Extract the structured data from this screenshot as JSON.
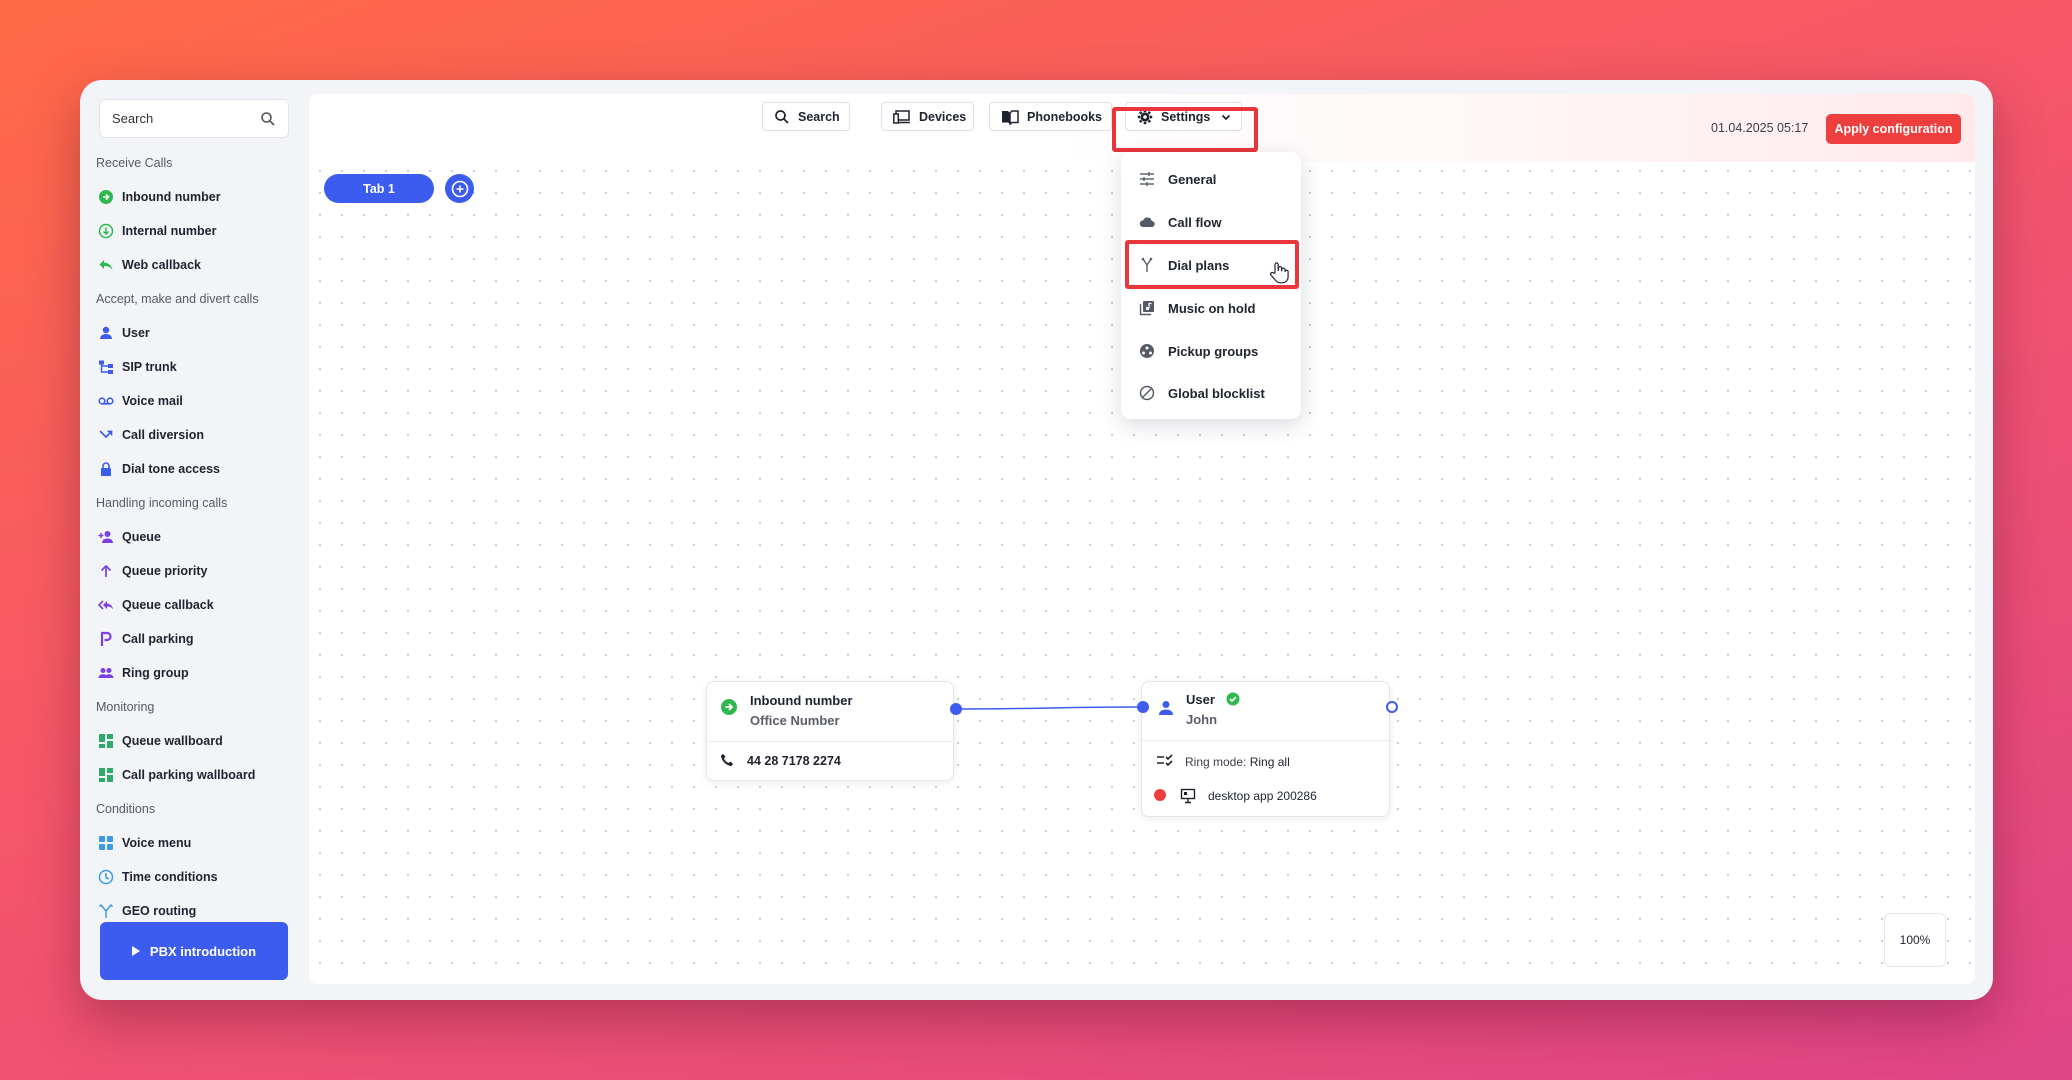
{
  "sidebar": {
    "search_label": "Search",
    "sections": [
      {
        "title": "Receive Calls",
        "items": [
          {
            "label": "Inbound number",
            "icon": "arrow-circle-right-icon"
          },
          {
            "label": "Internal number",
            "icon": "arrow-circle-down-icon"
          },
          {
            "label": "Web callback",
            "icon": "reply-icon"
          }
        ]
      },
      {
        "title": "Accept, make and divert calls",
        "items": [
          {
            "label": "User",
            "icon": "user-icon"
          },
          {
            "label": "SIP trunk",
            "icon": "sip-trunk-icon"
          },
          {
            "label": "Voice mail",
            "icon": "voicemail-icon"
          },
          {
            "label": "Call diversion",
            "icon": "call-diversion-icon"
          },
          {
            "label": "Dial tone access",
            "icon": "lock-icon"
          }
        ]
      },
      {
        "title": "Handling incoming calls",
        "items": [
          {
            "label": "Queue",
            "icon": "queue-user-add-icon"
          },
          {
            "label": "Queue priority",
            "icon": "arrow-up-icon"
          },
          {
            "label": "Queue callback",
            "icon": "reply-all-icon"
          },
          {
            "label": "Call parking",
            "icon": "parking-icon"
          },
          {
            "label": "Ring group",
            "icon": "group-icon"
          }
        ]
      },
      {
        "title": "Monitoring",
        "items": [
          {
            "label": "Queue wallboard",
            "icon": "dashboard-icon"
          },
          {
            "label": "Call parking wallboard",
            "icon": "dashboard-icon"
          }
        ]
      },
      {
        "title": "Conditions",
        "items": [
          {
            "label": "Voice menu",
            "icon": "grid-icon"
          },
          {
            "label": "Time conditions",
            "icon": "clock-icon"
          },
          {
            "label": "GEO routing",
            "icon": "fork-icon"
          }
        ]
      }
    ],
    "pbx_button": "PBX introduction"
  },
  "topbar": {
    "search": "Search",
    "devices": "Devices",
    "phonebooks": "Phonebooks",
    "settings": "Settings",
    "date": "01.04.2025 05:17",
    "apply": "Apply configuration"
  },
  "tabs": {
    "tab1": "Tab 1"
  },
  "settings_menu": [
    {
      "label": "General",
      "icon": "sliders-icon"
    },
    {
      "label": "Call flow",
      "icon": "cloud-icon"
    },
    {
      "label": "Dial plans",
      "icon": "fork-icon"
    },
    {
      "label": "Music on hold",
      "icon": "music-library-icon"
    },
    {
      "label": "Pickup groups",
      "icon": "pickup-groups-icon"
    },
    {
      "label": "Global blocklist",
      "icon": "block-icon"
    }
  ],
  "nodes": {
    "inbound": {
      "title": "Inbound number",
      "subtitle": "Office Number",
      "phone": "44 28 7178 2274"
    },
    "user": {
      "title": "User",
      "subtitle": "John",
      "ring_mode_label": "Ring mode:",
      "ring_mode_value": "Ring all",
      "device": "desktop app 200286"
    }
  },
  "zoom": "100%",
  "colors": {
    "accent": "#3c5cf0",
    "apply": "#ef3e3e",
    "highlight": "#e8363b",
    "green": "#2fb84f"
  }
}
